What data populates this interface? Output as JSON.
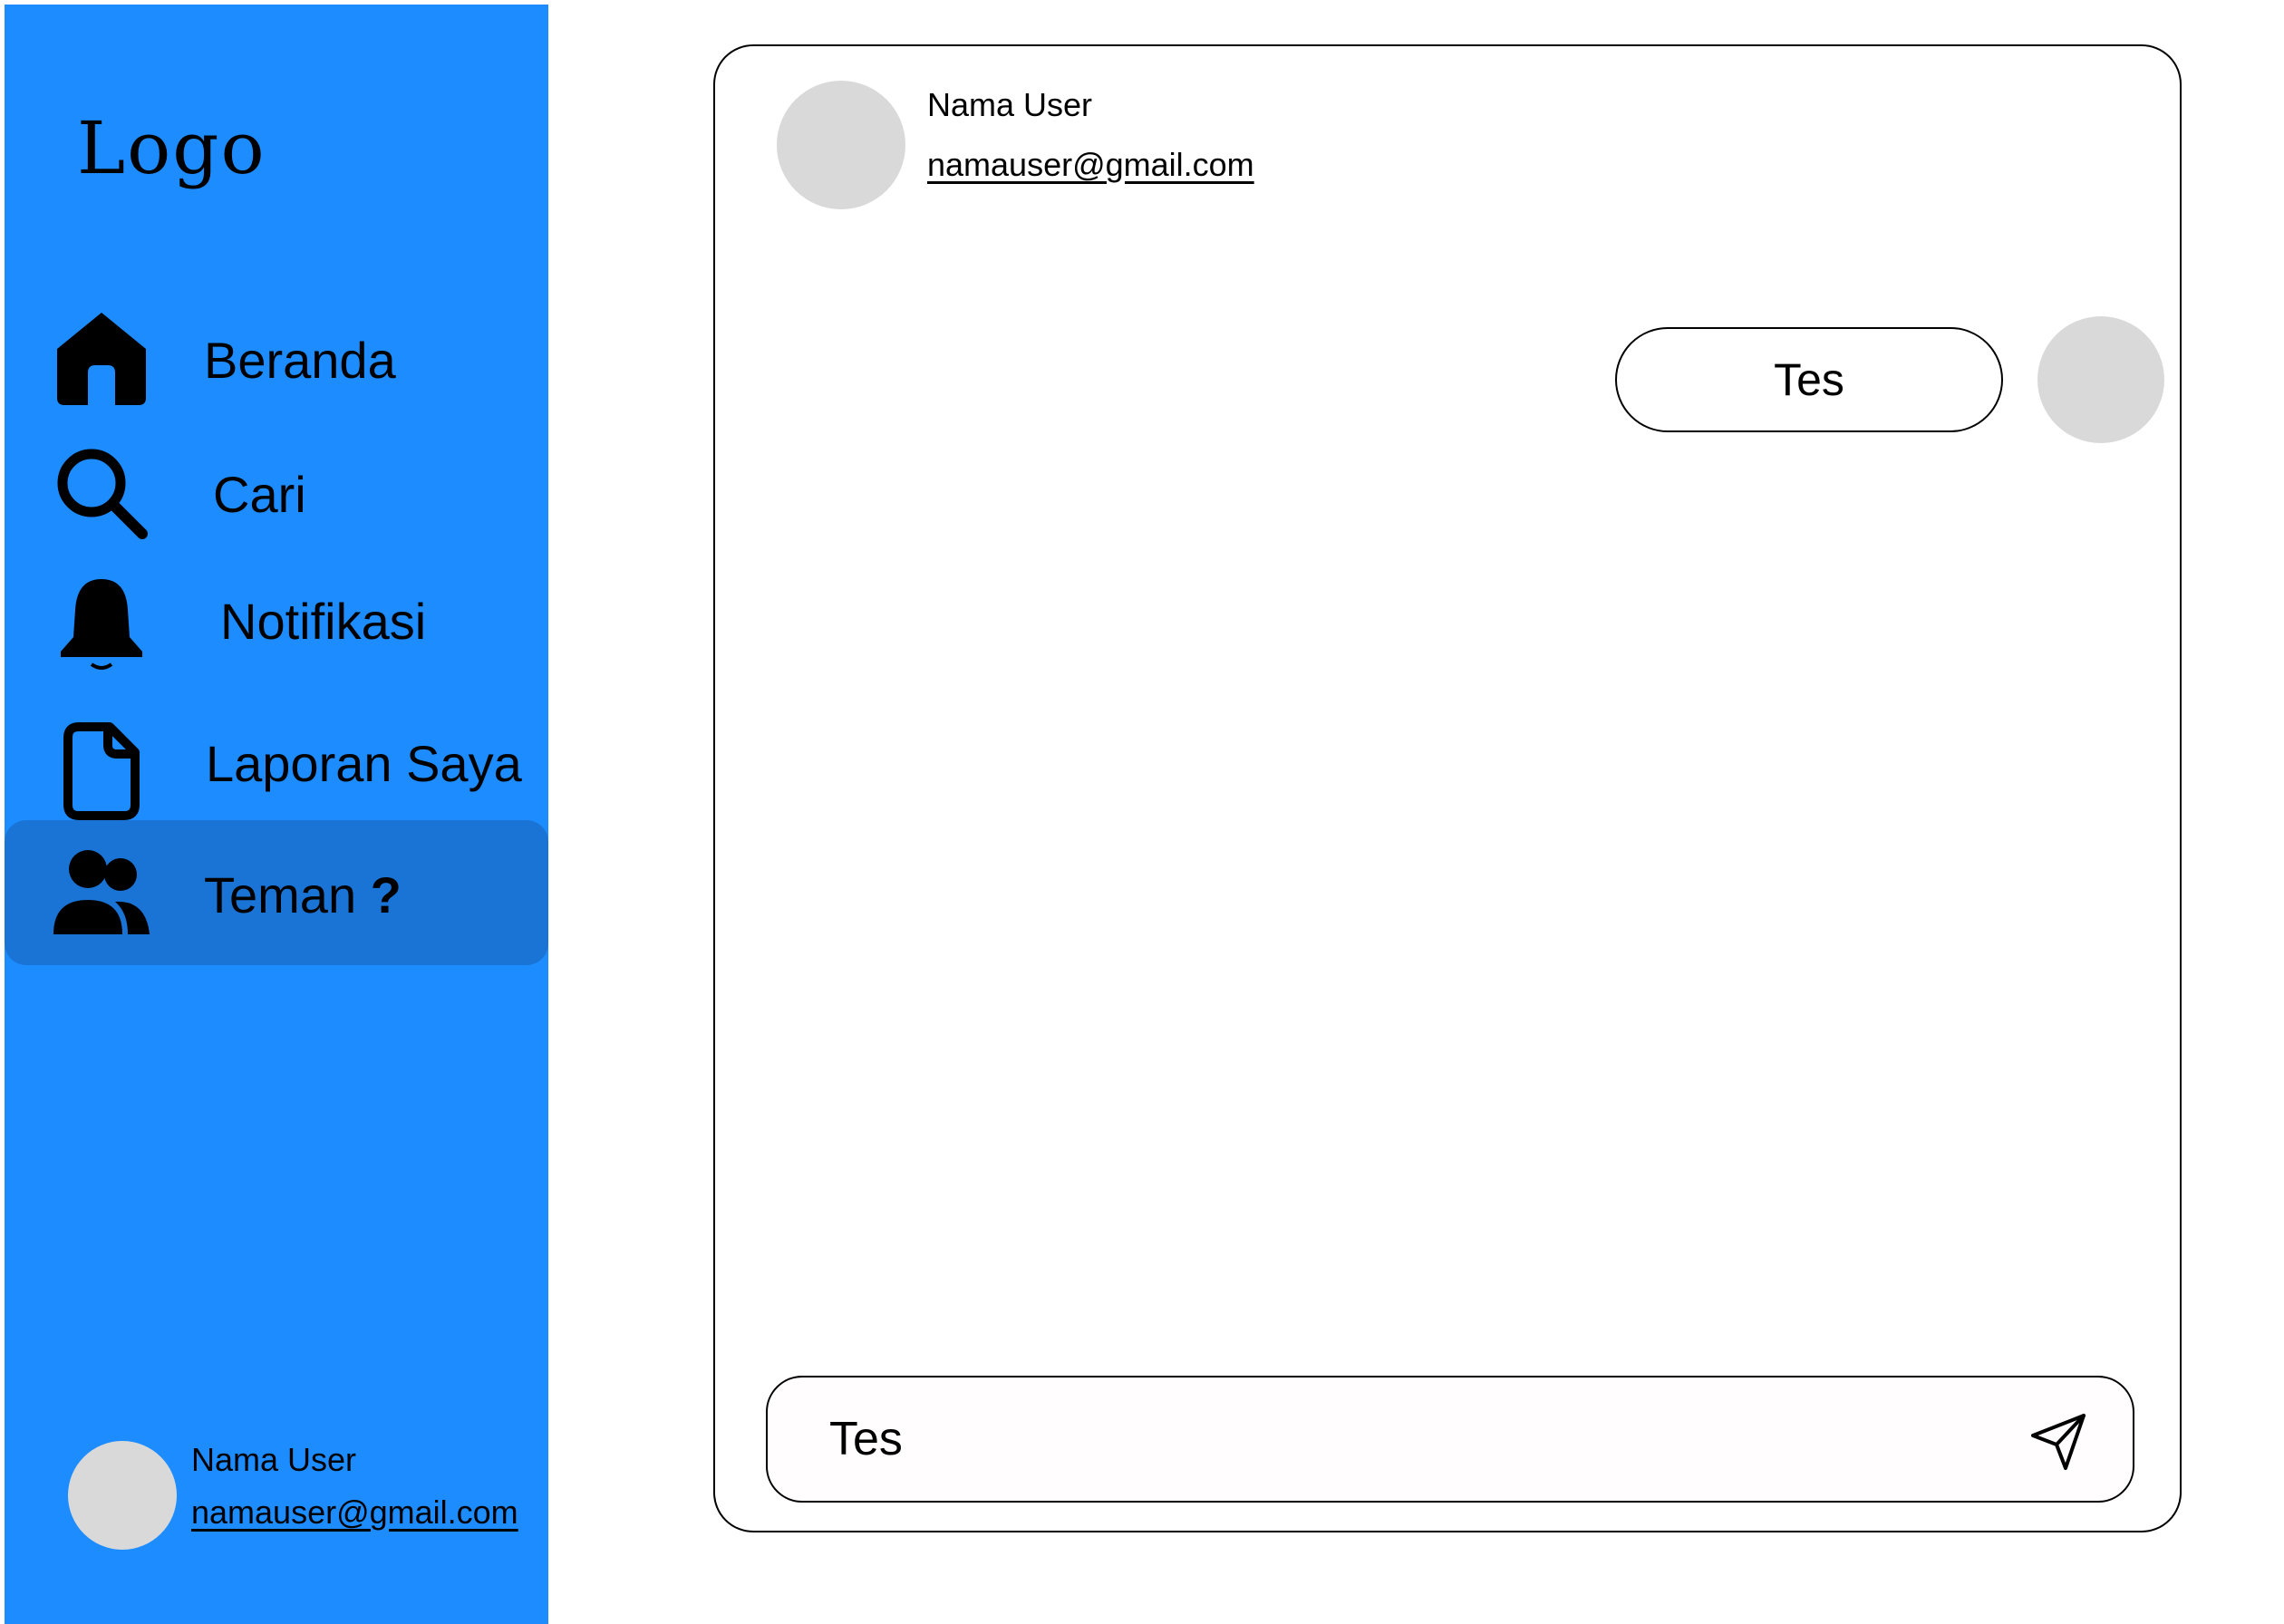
{
  "sidebar": {
    "logo": "Logo",
    "items": [
      {
        "label": "Beranda",
        "icon": "home-icon"
      },
      {
        "label": "Cari",
        "icon": "search-icon"
      },
      {
        "label": "Notifikasi",
        "icon": "bell-icon"
      },
      {
        "label": "Laporan Saya",
        "icon": "document-icon"
      },
      {
        "label": "Teman",
        "suffix": "?",
        "icon": "users-icon",
        "active": true
      }
    ],
    "user": {
      "name": "Nama User",
      "email": "namauser@gmail.com"
    }
  },
  "chat": {
    "header": {
      "name": "Nama User",
      "email": "namauser@gmail.com"
    },
    "messages": [
      {
        "text": "Tes",
        "side": "right"
      }
    ],
    "input": {
      "value": "Tes",
      "send_icon": "send-icon"
    }
  },
  "colors": {
    "sidebar": "#1d8cff",
    "active_item": "#1a74d6",
    "avatar": "#d9d9d9"
  }
}
